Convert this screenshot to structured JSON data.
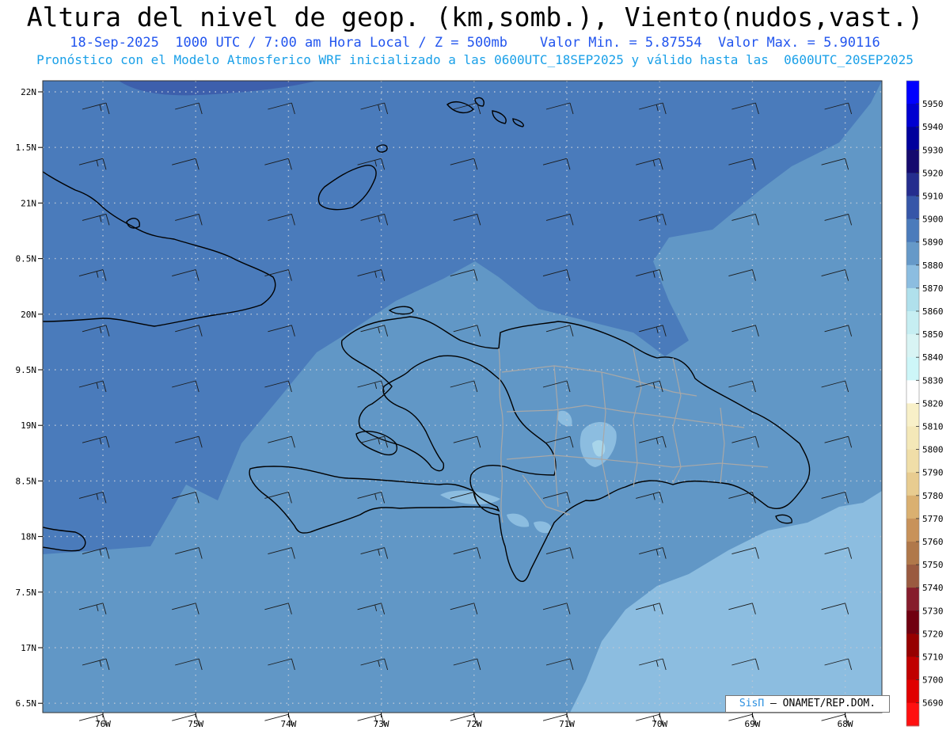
{
  "title": "Altura del nivel de geop. (km,somb.), Viento(nudos,vast.)",
  "subtitle_line1": "18-Sep-2025  1000 UTC / 7:00 am Hora Local / Z = 500mb    Valor Min. = 5.87554  Valor Max. = 5.90116",
  "subtitle_line2": "Pronóstico con el Modelo Atmosferico WRF inicializado a las 0600UTC_18SEP2025 y válido hasta las  0600UTC_20SEP2025",
  "credit": {
    "brand": "SisΠ",
    "text": "– ONAMET/REP.DOM."
  },
  "axes": {
    "lat_labels": [
      "22N",
      "1.5N",
      "21N",
      "0.5N",
      "20N",
      "9.5N",
      "19N",
      "8.5N",
      "18N",
      "7.5N",
      "17N",
      "6.5N"
    ],
    "lon_labels": [
      "76W",
      "75W",
      "74W",
      "73W",
      "72W",
      "71W",
      "70W",
      "69W",
      "68W"
    ]
  },
  "colorbar": {
    "levels": [
      5950,
      5940,
      5930,
      5920,
      5910,
      5900,
      5890,
      5880,
      5870,
      5860,
      5850,
      5840,
      5830,
      5820,
      5810,
      5800,
      5790,
      5780,
      5770,
      5760,
      5750,
      5740,
      5730,
      5720,
      5710,
      5700,
      5690
    ],
    "colors": [
      "#0000ff",
      "#0000d0",
      "#00009c",
      "#150a6e",
      "#252d8e",
      "#3656a8",
      "#4b7bbb",
      "#6699c8",
      "#8cbde0",
      "#b0e0ec",
      "#c6eef2",
      "#d8f4f4",
      "#cdf6f8",
      "#ffffff",
      "#f8f0c8",
      "#f4e8b8",
      "#f0dea8",
      "#e8cc90",
      "#dab070",
      "#c8925a",
      "#b0784a",
      "#9a5a40",
      "#861c2c",
      "#700010",
      "#960000",
      "#c00000",
      "#e00000",
      "#ff1010"
    ]
  },
  "colors": {
    "shade_5900": "#3d5fac",
    "shade_5890": "#4a7bbb",
    "shade_5880": "#6197c6",
    "shade_5870": "#8cbde0",
    "shade_5860": "#a8d5ea"
  }
}
